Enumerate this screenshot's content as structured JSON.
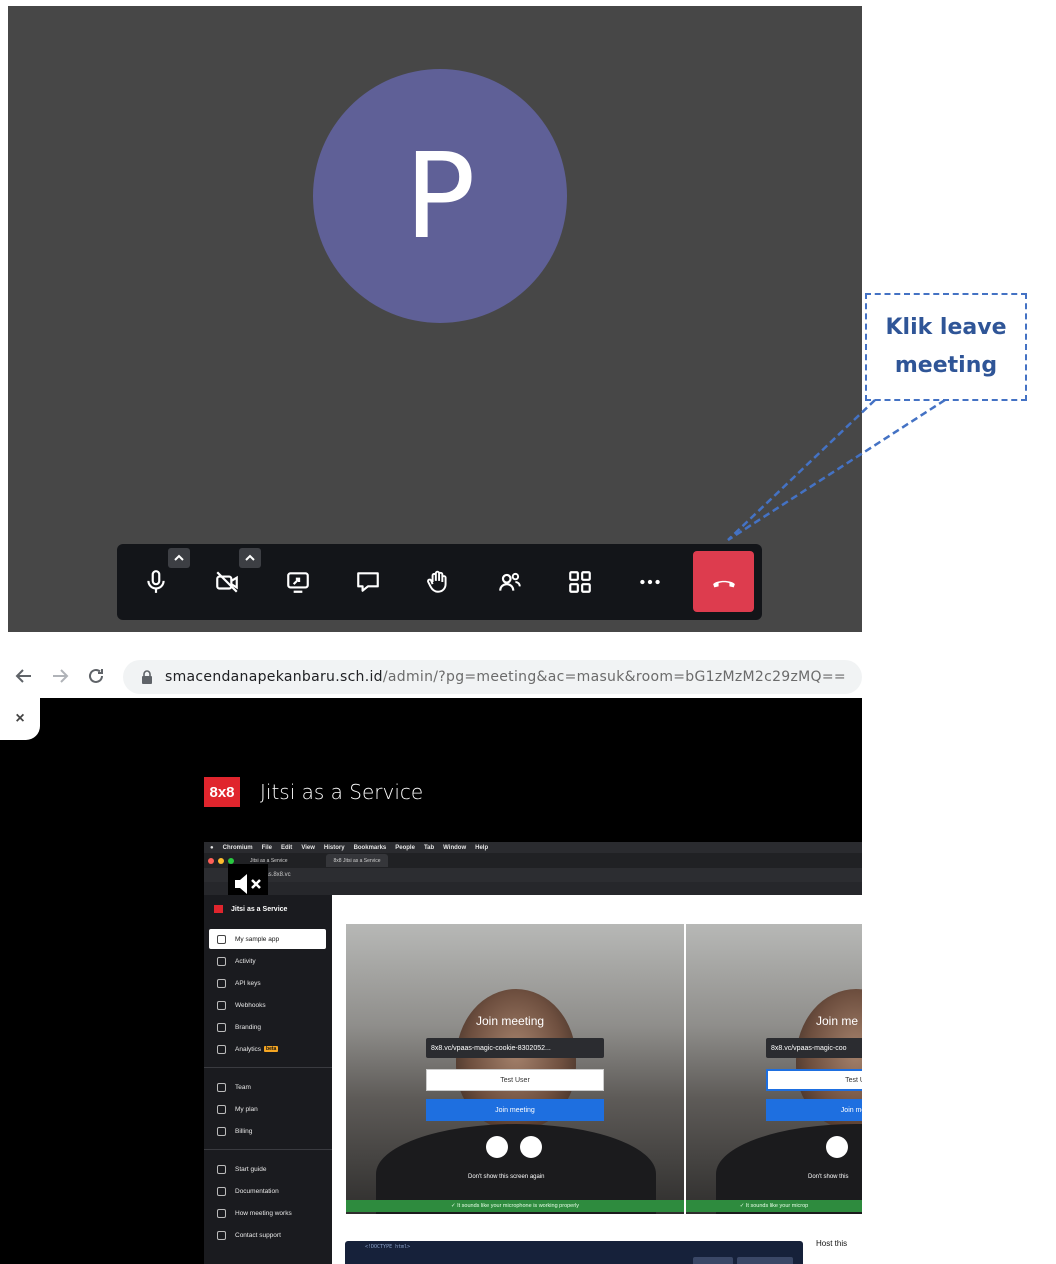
{
  "meeting": {
    "avatar_initial": "P",
    "toolbar": {
      "buttons": [
        "mic-icon",
        "camera-off-icon",
        "screen-share-icon",
        "chat-icon",
        "raise-hand-icon",
        "participants-icon",
        "tile-view-icon",
        "more-icon",
        "hangup-icon"
      ],
      "hangup_color": "#dd3c4e",
      "avatar_color": "#5f6097"
    }
  },
  "callout": {
    "text": "Klik leave meeting",
    "color": "#4472c4"
  },
  "browser": {
    "url_domain": "smacendanapekanbaru.sch.id",
    "url_path": "/admin/?pg=meeting&ac=masuk&room=bG1zMzM2c29zMQ==",
    "close_label": "×"
  },
  "jaas": {
    "brand_logo": "8x8",
    "brand_title": "Jitsi as a Service",
    "mac_menu": [
      "Chromium",
      "File",
      "Edit",
      "View",
      "History",
      "Bookmarks",
      "People",
      "Tab",
      "Window",
      "Help"
    ],
    "tab1": "Jitsi as a Service",
    "tab2": "8x8 Jitsi as a Service",
    "address": "aas.8x8.vc",
    "sidebar": {
      "app_title": "Jitsi as a Service",
      "items": [
        "My sample app",
        "Activity",
        "API keys",
        "Webhooks",
        "Branding",
        "Analytics",
        "Team",
        "My plan",
        "Billing",
        "Start guide",
        "Documentation",
        "How meeting works",
        "Contact support"
      ],
      "beta_badge": "beta"
    },
    "left_panel": {
      "title": "Join meeting",
      "link": "8x8.vc/vpaas-magic-cookie-8302052...",
      "user": "Test User",
      "join": "Join meeting",
      "dont_show": "Don't show this screen again",
      "mic_ok": "✓  It sounds like your microphone is working properly"
    },
    "right_panel": {
      "title": "Join me",
      "link": "8x8.vc/vpaas-magic-coo",
      "user": "Test U",
      "join": "Join mee",
      "dont_show": "Don't show this",
      "mic_ok": "✓  It sounds like your microp"
    },
    "code_snippet": "<!DOCTYPE html>",
    "host_this": "Host this"
  }
}
